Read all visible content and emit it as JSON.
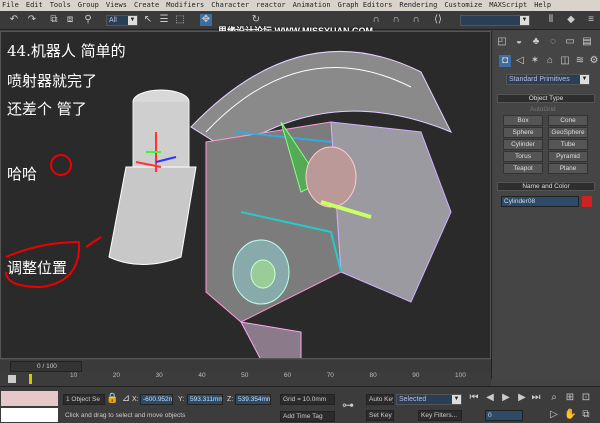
{
  "menu": [
    "File",
    "Edit",
    "Tools",
    "Group",
    "Views",
    "Create",
    "Modifiers",
    "Character",
    "reactor",
    "Animation",
    "Graph Editors",
    "Rendering",
    "Customize",
    "MAXScript",
    "Help"
  ],
  "toolbar": {
    "selection_filter": "All",
    "watermark": "思缘设计论坛 WWW.MISSYUAN.COM"
  },
  "annotations": [
    "44.机器人 简单的",
    "喷射器就完了",
    "还差个 管了",
    "哈哈",
    "调整位置"
  ],
  "panel": {
    "category": "Standard Primitives",
    "object_type_title": "Object Type",
    "autogrid": "AutoGrid",
    "buttons": [
      "Box",
      "Cone",
      "Sphere",
      "GeoSphere",
      "Cylinder",
      "Tube",
      "Torus",
      "Pyramid",
      "Teapot",
      "Plane"
    ],
    "name_color_title": "Name and Color",
    "object_name": "Cylinder08",
    "object_color": "#cc2222"
  },
  "timeline": {
    "frame": "0 / 100",
    "ticks": [
      "10",
      "20",
      "30",
      "40",
      "50",
      "60",
      "70",
      "80",
      "90",
      "100"
    ]
  },
  "status": {
    "selection": "1 Object Se",
    "x_label": "X:",
    "x": "-600.952m",
    "y_label": "Y:",
    "y": "593.311mm",
    "z_label": "Z:",
    "z": "539.354mm",
    "grid": "Grid = 10.0mm",
    "prompt": "Click and drag to select and move objects",
    "add_time_tag": "Add Time Tag",
    "auto_key": "Auto Key",
    "key_mode": "Selected",
    "set_key": "Set Key",
    "key_filters": "Key Filters...",
    "current_frame": "0"
  }
}
